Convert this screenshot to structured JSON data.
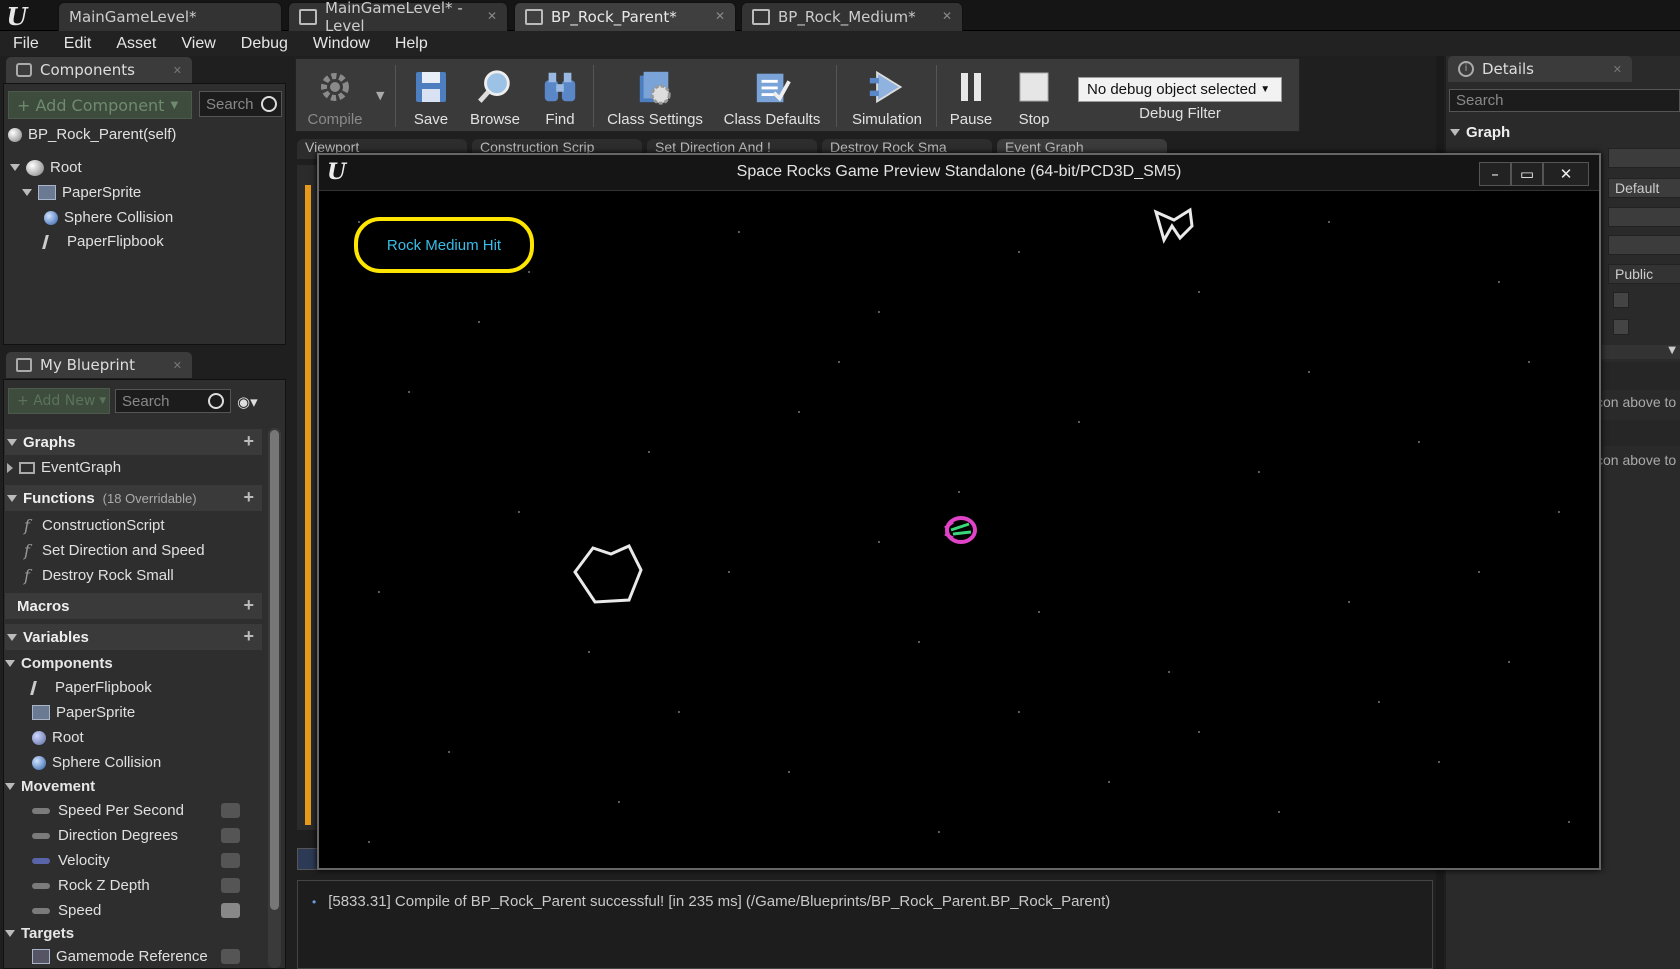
{
  "document_tabs": [
    "MainGameLevel*",
    "MainGameLevel* - Level",
    "BP_Rock_Parent*",
    "BP_Rock_Medium*"
  ],
  "menu": [
    "File",
    "Edit",
    "Asset",
    "View",
    "Debug",
    "Window",
    "Help"
  ],
  "components_panel": {
    "title": "Components",
    "add_label": "+ Add Component",
    "search_placeholder": "Search",
    "self_label": "BP_Rock_Parent(self)",
    "tree": [
      "Root",
      "PaperSprite",
      "Sphere Collision",
      "PaperFlipbook"
    ]
  },
  "my_blueprint": {
    "title": "My Blueprint",
    "add_new": "+ Add New",
    "search_placeholder": "Search",
    "graphs_header": "Graphs",
    "graphs": [
      "EventGraph"
    ],
    "functions_header": "Functions",
    "functions_note": "(18 Overridable)",
    "functions": [
      "ConstructionScript",
      "Set Direction and Speed",
      "Destroy Rock Small"
    ],
    "macros_header": "Macros",
    "variables_header": "Variables",
    "components_group": "Components",
    "component_vars": [
      "PaperFlipbook",
      "PaperSprite",
      "Root",
      "Sphere Collision"
    ],
    "movement_group": "Movement",
    "movement_vars": [
      "Speed Per Second",
      "Direction Degrees",
      "Velocity",
      "Rock Z Depth",
      "Speed"
    ],
    "targets_group": "Targets",
    "target_vars": [
      "Gamemode Reference"
    ]
  },
  "toolbar": {
    "compile": "Compile",
    "save": "Save",
    "browse": "Browse",
    "find": "Find",
    "class_settings": "Class Settings",
    "class_defaults": "Class Defaults",
    "simulation": "Simulation",
    "pause": "Pause",
    "stop": "Stop",
    "debug_object": "No debug object selected",
    "debug_filter": "Debug Filter"
  },
  "editor_tabs": [
    "Viewport",
    "Construction Scrip",
    "Set Direction And !",
    "Destroy Rock Sma",
    "Event Graph"
  ],
  "game_window": {
    "title": "Space Rocks Game Preview Standalone (64-bit/PCD3D_SM5)",
    "hit_text": "Rock Medium Hit"
  },
  "details": {
    "title": "Details",
    "search_placeholder": "Search",
    "graph_header": "Graph",
    "field_default": "Default",
    "field_public": "Public",
    "hint_1": "con above to",
    "hint_2": "con above to"
  },
  "log": {
    "bullet": "•",
    "message": "[5833.31] Compile of BP_Rock_Parent successful! [in 235 ms] (/Game/Blueprints/BP_Rock_Parent.BP_Rock_Parent)"
  },
  "colors": {
    "highlight": "#ffe600",
    "hit_text": "#37bde8",
    "accent_orange": "#e89a1a"
  }
}
